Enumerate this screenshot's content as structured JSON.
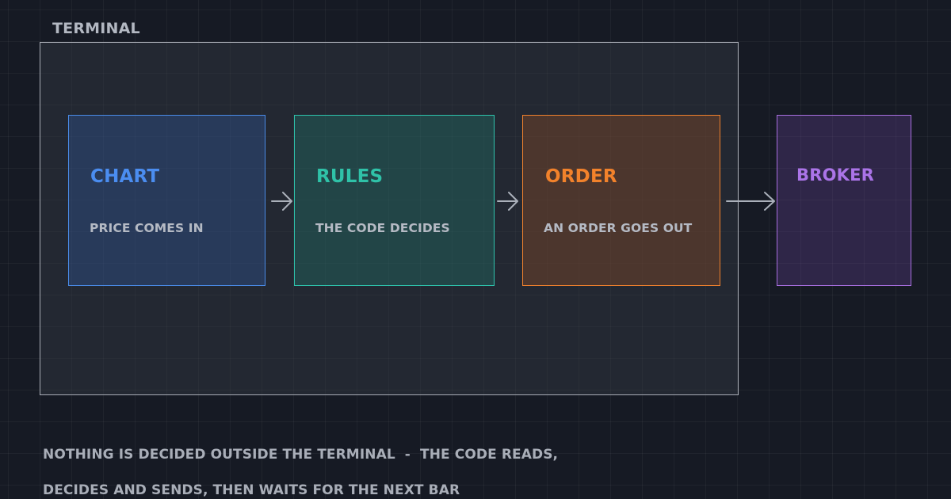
{
  "terminal": {
    "label": "TERMINAL"
  },
  "nodes": [
    {
      "id": "chart",
      "title": "CHART",
      "subtitle": "PRICE COMES IN",
      "color": "#4b8df0"
    },
    {
      "id": "rules",
      "title": "RULES",
      "subtitle": "THE CODE DECIDES",
      "color": "#2fc2a8"
    },
    {
      "id": "order",
      "title": "ORDER",
      "subtitle": "AN ORDER GOES OUT",
      "color": "#f2822b"
    },
    {
      "id": "broker",
      "title": "BROKER",
      "subtitle": "",
      "color": "#ab74e8"
    }
  ],
  "footer": {
    "line1": "NOTHING IS DECIDED OUTSIDE THE TERMINAL  -  THE CODE READS,",
    "line2": "DECIDES AND SENDS, THEN WAITS FOR THE NEXT BAR"
  },
  "colors": {
    "background": "#161a24",
    "arrow": "#aab0ba",
    "frame": "#a9adb6"
  }
}
